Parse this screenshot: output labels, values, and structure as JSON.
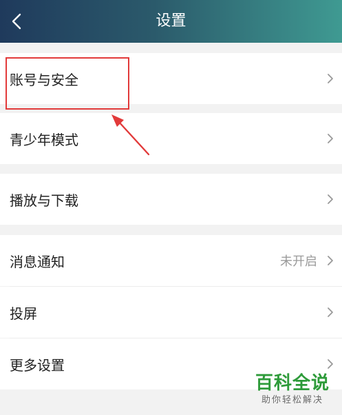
{
  "header": {
    "title": "设置"
  },
  "settings": {
    "account_security": "账号与安全",
    "youth_mode": "青少年模式",
    "playback_download": "播放与下载",
    "notifications": "消息通知",
    "notifications_status": "未开启",
    "screen_cast": "投屏",
    "more_settings": "更多设置"
  },
  "watermark": {
    "title": "百科全说",
    "subtitle": "助你轻松解决"
  },
  "colors": {
    "highlight": "#e23a3a",
    "watermark_green": "#2e9b3a"
  },
  "icons": {
    "back": "back-arrow-icon",
    "chevron": "chevron-right-icon"
  }
}
